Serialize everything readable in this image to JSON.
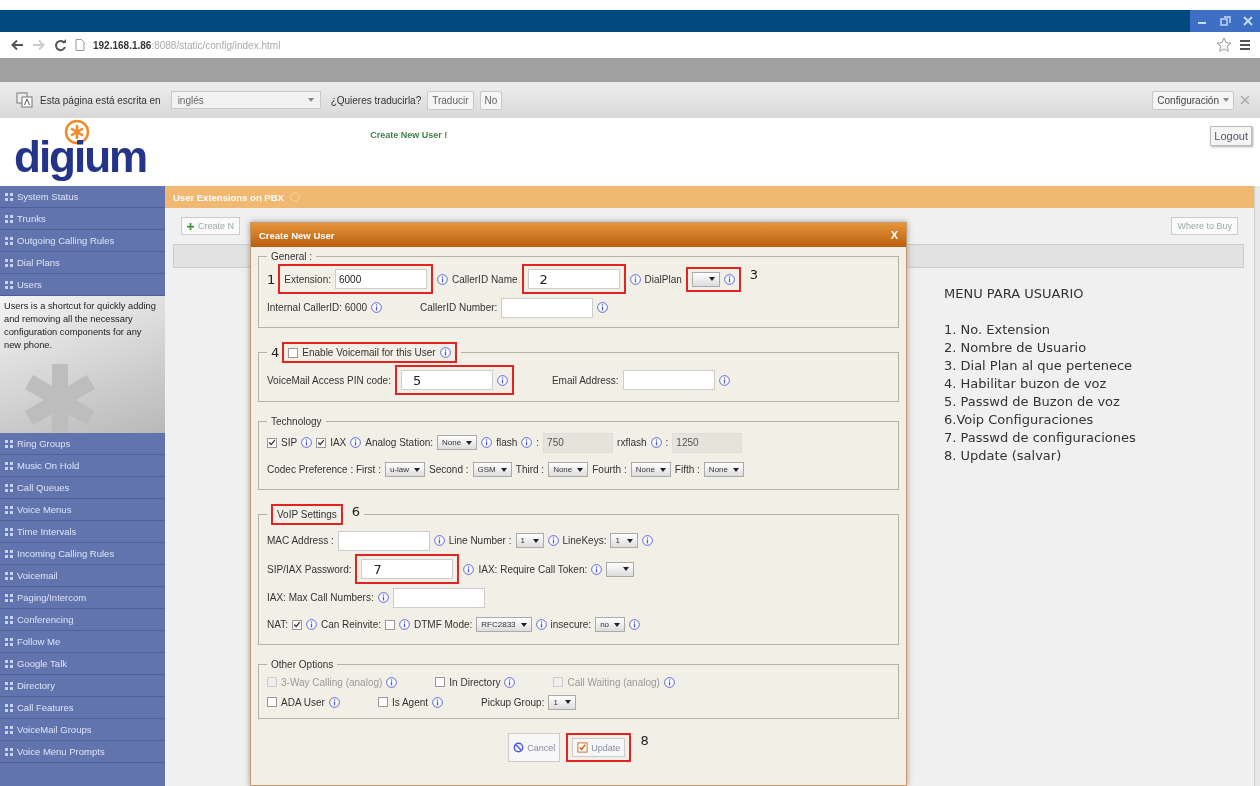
{
  "browser": {
    "url": "**192.168.1.86**:8088/static/config/index.html"
  },
  "translate_bar": {
    "prefix": "Esta página está escrita en",
    "language": "inglés",
    "question": "¿Quieres traducirla?",
    "buttons": [
      "Traducir",
      "No"
    ],
    "options": "Configuración"
  },
  "header": {
    "logo": "digium",
    "notice": "Create New User !",
    "logout": "Logout"
  },
  "sidebar": {
    "items": [
      {
        "label": "System Status"
      },
      {
        "label": "Trunks"
      },
      {
        "label": "Outgoing Calling Rules"
      },
      {
        "label": "Dial Plans"
      },
      {
        "label": "Users",
        "description": "Users is a shortcut for quickly adding and removing all the necessary configuration components for any new phone."
      },
      {
        "label": "Ring Groups"
      },
      {
        "label": "Music On Hold"
      },
      {
        "label": "Call Queues"
      },
      {
        "label": "Voice Menus"
      },
      {
        "label": "Time Intervals"
      },
      {
        "label": "Incoming Calling Rules"
      },
      {
        "label": "Voicemail"
      },
      {
        "label": "Paging/Intercom"
      },
      {
        "label": "Conferencing"
      },
      {
        "label": "Follow Me"
      },
      {
        "label": "Google Talk"
      },
      {
        "label": "Directory"
      },
      {
        "label": "Call Features"
      },
      {
        "label": "VoiceMail Groups"
      },
      {
        "label": "Voice Menu Prompts"
      }
    ]
  },
  "content": {
    "title": "User Extensions on PBX",
    "create_button": "Create N",
    "where_button": "Where to Buy"
  },
  "help": {
    "title": "MENU PARA USUARIO",
    "lines": [
      "1. No. Extension",
      "2. Nombre de Usuario",
      "3. Dial Plan al que pertenece",
      "4. Habilitar buzon de voz",
      "5. Passwd de Buzon de voz",
      "6.Voip Configuraciones",
      "7. Passwd de configuraciones",
      "8. Update (salvar)"
    ]
  },
  "dialog": {
    "title": "Create New User",
    "close": "X",
    "sections": [
      {
        "legend": [
          {
            "kind": "label",
            "text": "General :"
          }
        ],
        "lines": [
          {
            "items": [
              {
                "kind": "mark_left",
                "number": "1",
                "items": [
                  {
                    "kind": "label",
                    "text": "Extension:"
                  },
                  {
                    "kind": "input",
                    "value": "6000"
                  }
                ]
              },
              {
                "kind": "info"
              },
              {
                "kind": "label",
                "text": "CallerID Name"
              },
              {
                "kind": "mark_inside",
                "number": "2",
                "items": [
                  {
                    "kind": "input"
                  }
                ]
              },
              {
                "kind": "info"
              },
              {
                "kind": "label",
                "text": "DialPlan"
              },
              {
                "kind": "mark_right",
                "number": "3",
                "items": [
                  {
                    "kind": "select"
                  },
                  {
                    "kind": "info"
                  }
                ]
              }
            ]
          },
          {
            "items": [
              {
                "kind": "label",
                "text": "Internal CallerID: 6000"
              },
              {
                "kind": "info"
              },
              {
                "kind": "gap"
              },
              {
                "kind": "label",
                "text": "CallerID Number:"
              },
              {
                "kind": "input"
              },
              {
                "kind": "info"
              }
            ]
          }
        ]
      },
      {
        "legend": [
          {
            "kind": "mark_left",
            "number": "4",
            "items": [
              {
                "kind": "checkbox",
                "label": "Enable Voicemail for this User",
                "checked": false,
                "disabled": false
              },
              {
                "kind": "info"
              }
            ]
          }
        ],
        "lines": [
          {
            "items": [
              {
                "kind": "label",
                "text": "VoiceMail Access PIN code:"
              },
              {
                "kind": "mark_inside",
                "number": "5",
                "items": [
                  {
                    "kind": "input"
                  },
                  {
                    "kind": "info"
                  }
                ]
              },
              {
                "kind": "gap"
              },
              {
                "kind": "label",
                "text": "Email Address:"
              },
              {
                "kind": "input"
              },
              {
                "kind": "info"
              }
            ]
          }
        ]
      },
      {
        "legend": [
          {
            "kind": "label",
            "text": "Technology"
          }
        ],
        "lines": [
          {
            "items": [
              {
                "kind": "checkbox",
                "label": "SIP",
                "checked": true,
                "disabled": false
              },
              {
                "kind": "info"
              },
              {
                "kind": "checkbox",
                "label": "IAX",
                "checked": true,
                "disabled": false
              },
              {
                "kind": "info"
              },
              {
                "kind": "label",
                "text": "Analog Station:"
              },
              {
                "kind": "select",
                "value": "None"
              },
              {
                "kind": "info"
              },
              {
                "kind": "label",
                "text": "flash"
              },
              {
                "kind": "info"
              },
              {
                "kind": "label",
                "text": ":"
              },
              {
                "kind": "input",
                "value": "750",
                "disabled": true
              },
              {
                "kind": "label",
                "text": "rxflash"
              },
              {
                "kind": "info"
              },
              {
                "kind": "label",
                "text": ":"
              },
              {
                "kind": "input",
                "value": "1250",
                "disabled": true
              }
            ]
          },
          {
            "items": [
              {
                "kind": "label",
                "text": "Codec Preference : First :"
              },
              {
                "kind": "select",
                "value": "u-law"
              },
              {
                "kind": "label",
                "text": "Second :"
              },
              {
                "kind": "select",
                "value": "GSM"
              },
              {
                "kind": "label",
                "text": "Third :"
              },
              {
                "kind": "select",
                "value": "None"
              },
              {
                "kind": "label",
                "text": "Fourth :"
              },
              {
                "kind": "select",
                "value": "None"
              },
              {
                "kind": "label",
                "text": "Fifth :"
              },
              {
                "kind": "select",
                "value": "None"
              }
            ]
          }
        ]
      },
      {
        "legend": [
          {
            "kind": "mark_right",
            "number": "6",
            "items": [
              {
                "kind": "label",
                "text": "VoIP Settings"
              }
            ]
          }
        ],
        "lines": [
          {
            "items": [
              {
                "kind": "label",
                "text": "MAC Address :"
              },
              {
                "kind": "input"
              },
              {
                "kind": "info"
              },
              {
                "kind": "label",
                "text": "Line Number :"
              },
              {
                "kind": "select",
                "value": "1"
              },
              {
                "kind": "info"
              },
              {
                "kind": "label",
                "text": "LineKeys:"
              },
              {
                "kind": "select",
                "value": "1"
              },
              {
                "kind": "info"
              }
            ]
          },
          {
            "items": [
              {
                "kind": "label",
                "text": "SIP/IAX Password:"
              },
              {
                "kind": "mark_inside",
                "number": "7",
                "items": [
                  {
                    "kind": "input"
                  }
                ]
              },
              {
                "kind": "info"
              },
              {
                "kind": "label",
                "text": "IAX: Require Call Token:"
              },
              {
                "kind": "info"
              },
              {
                "kind": "select"
              }
            ]
          },
          {
            "items": [
              {
                "kind": "label",
                "text": "IAX: Max Call Numbers:"
              },
              {
                "kind": "info"
              },
              {
                "kind": "input"
              }
            ]
          },
          {
            "items": [
              {
                "kind": "label",
                "text": "NAT:"
              },
              {
                "kind": "checkbox",
                "checked": true,
                "disabled": false
              },
              {
                "kind": "info"
              },
              {
                "kind": "label",
                "text": "Can Reinvite:"
              },
              {
                "kind": "checkbox",
                "checked": false,
                "disabled": false
              },
              {
                "kind": "info"
              },
              {
                "kind": "label",
                "text": "DTMF Mode:"
              },
              {
                "kind": "select",
                "value": "RFC2833"
              },
              {
                "kind": "info"
              },
              {
                "kind": "label",
                "text": "insecure:"
              },
              {
                "kind": "select",
                "value": "no"
              },
              {
                "kind": "info"
              }
            ]
          }
        ]
      },
      {
        "legend": [
          {
            "kind": "label",
            "text": "Other Options"
          }
        ],
        "lines": [
          {
            "items": [
              {
                "kind": "checkbox",
                "label": "3-Way Calling (analog)",
                "checked": false,
                "disabled": true
              },
              {
                "kind": "info"
              },
              {
                "kind": "gap"
              },
              {
                "kind": "checkbox",
                "label": "In Directory",
                "checked": false,
                "disabled": false
              },
              {
                "kind": "info"
              },
              {
                "kind": "gap"
              },
              {
                "kind": "checkbox",
                "label": "Call Waiting (analog)",
                "checked": false,
                "disabled": true
              },
              {
                "kind": "info"
              }
            ]
          },
          {
            "items": [
              {
                "kind": "checkbox",
                "label": "ADA User",
                "checked": false,
                "disabled": false
              },
              {
                "kind": "info"
              },
              {
                "kind": "gap"
              },
              {
                "kind": "checkbox",
                "label": "Is Agent",
                "checked": false,
                "disabled": false
              },
              {
                "kind": "info"
              },
              {
                "kind": "gap"
              },
              {
                "kind": "label",
                "text": "Pickup Group:"
              },
              {
                "kind": "select",
                "value": "1"
              }
            ]
          }
        ]
      }
    ],
    "footer": [
      {
        "kind": "cancel",
        "text": "Cancel"
      },
      {
        "kind": "mark_right",
        "number": "8",
        "items": [
          {
            "kind": "update",
            "text": "Update"
          }
        ]
      }
    ]
  }
}
